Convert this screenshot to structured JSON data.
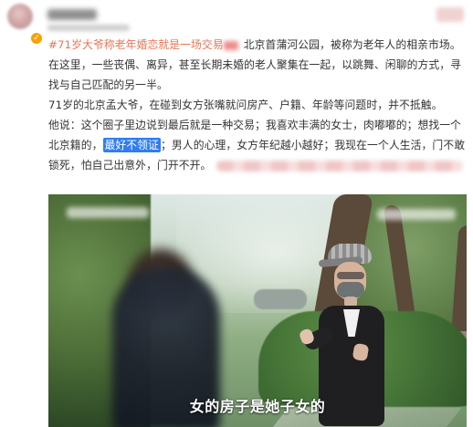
{
  "post": {
    "lines": [
      {
        "tag": "#71岁大爷称老年婚恋就是一场交易",
        "rest": "北京首蒲河公园，被称为老年人的相亲市场。"
      },
      {
        "text": "在这里，一些丧偶、离异，甚至长期未婚的老人聚集在一起，以跳舞、闲聊的方式，寻"
      },
      {
        "text": "找与自己匹配的另一半。"
      },
      {
        "text": "71岁的北京孟大爷，在碰到女方张嘴就问房产、户籍、年龄等问题时，并不抵触。"
      },
      {
        "text": "他说：这个圈子里边说到最后就是一种交易；我喜欢丰满的女士，肉嘟嘟的；想找一个"
      },
      {
        "text_before": "北京籍的，",
        "highlight": "最好不领证",
        "text_after": "；男人的心理，女方年纪越小越好；我现在一个人生活，门不敢"
      },
      {
        "text": "锁死，怕自己出意外，门开不开。"
      }
    ]
  },
  "video": {
    "subtitle": "女的房子是她子女的"
  },
  "colors": {
    "tag": "#eb7350",
    "highlight": "#2f7cf3",
    "text": "#333333"
  },
  "icons": {
    "verification": "verification-badge-icon"
  }
}
